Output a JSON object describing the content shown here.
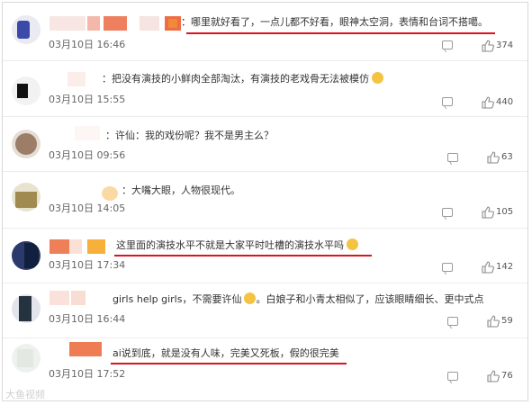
{
  "comments": [
    {
      "prefix": "：",
      "text": "哪里就好看了，一点儿都不好看，眼神太空洞，表情和台词不搭噶。",
      "date": "03月10日 16:46",
      "likes": "374"
    },
    {
      "prefix": "：",
      "text": "把没有演技的小鲜肉全部淘汰，有演技的老戏骨无法被模仿",
      "date": "03月10日 15:55",
      "likes": "440"
    },
    {
      "prefix": "：",
      "text": "许仙：我的戏份呢？我不是男主么？",
      "date": "03月10日 09:56",
      "likes": "63"
    },
    {
      "prefix": "：",
      "text": "大嘴大眼，人物很现代。",
      "date": "03月10日 14:05",
      "likes": "105"
    },
    {
      "prefix": "",
      "text": "这里面的演技水平不就是大家平时吐槽的演技水平吗",
      "date": "03月10日 17:34",
      "likes": "142"
    },
    {
      "prefix": "",
      "text": "girls help girls，不需要许仙",
      "text2": "。白娘子和小青太相似了，应该眼睛细长、更中式点",
      "date": "03月10日 16:44",
      "likes": "59"
    },
    {
      "prefix": "",
      "text": "ai说到底，就是没有人味，完美又死板，假的很完美",
      "date": "03月10日 17:52",
      "likes": "76"
    }
  ],
  "watermark": "大鱼视频",
  "colors": {
    "underline": "#d9151e",
    "like_icon": "#8a8a8a"
  }
}
